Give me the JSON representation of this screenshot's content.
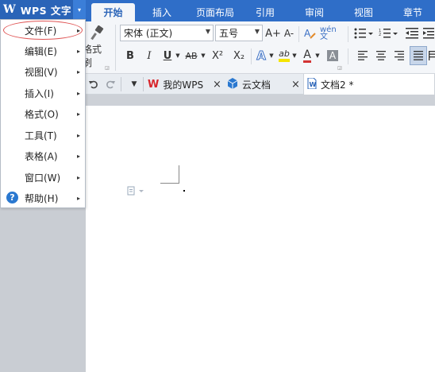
{
  "app": {
    "logo": "W",
    "name": "WPS 文字",
    "dropdown_glyph": "▾"
  },
  "ribbon_tabs": [
    "开始",
    "插入",
    "页面布局",
    "引用",
    "审阅",
    "视图",
    "章节"
  ],
  "ribbon": {
    "format_painter_label": "格式刷",
    "font_name": "宋体 (正文)",
    "font_size": "五号",
    "grow_font": "A+",
    "shrink_font": "A-",
    "phonetic": "wén 文",
    "bold": "B",
    "italic": "I",
    "underline": "U",
    "strikethrough": "AB",
    "superscript": "X²",
    "subscript": "X₂",
    "text_effect": "A",
    "highlight": "ab",
    "font_color": "A",
    "char_shading": "A",
    "colors": {
      "highlight": "#f5e400",
      "font_color": "#d33333",
      "accent": "#2f6ec8"
    }
  },
  "doc_tabs": [
    {
      "label": "我的WPS",
      "icon": "wps-logo-icon"
    },
    {
      "label": "云文档",
      "icon": "cloud-doc-icon"
    },
    {
      "label": "文档2 *",
      "icon": "document-icon"
    }
  ],
  "close_glyph": "×",
  "menu": {
    "items": [
      {
        "label": "文件(F)"
      },
      {
        "label": "编辑(E)"
      },
      {
        "label": "视图(V)"
      },
      {
        "label": "插入(I)"
      },
      {
        "label": "格式(O)"
      },
      {
        "label": "工具(T)"
      },
      {
        "label": "表格(A)"
      },
      {
        "label": "窗口(W)"
      },
      {
        "label": "帮助(H)"
      }
    ],
    "help_glyph": "?",
    "chevron": "▸"
  }
}
